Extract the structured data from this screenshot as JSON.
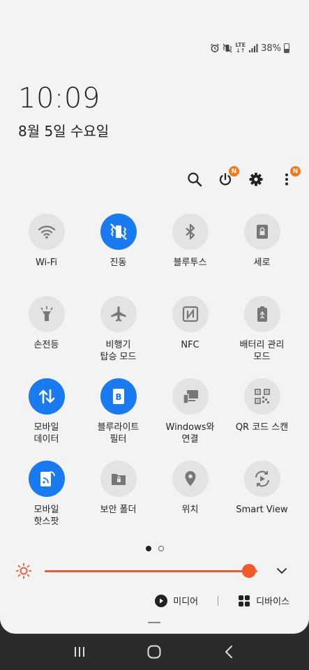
{
  "status_bar": {
    "lte_top": "LTE",
    "lte_bottom": "↓↑",
    "battery_text": "38%",
    "icons": [
      "alarm-icon",
      "vibrate-icon",
      "lte-icon",
      "signal-icon",
      "battery-icon"
    ]
  },
  "clock": {
    "time": "10:09",
    "date": "8월 5일 수요일"
  },
  "header_actions": {
    "power_badge": "N",
    "more_badge": "N"
  },
  "tiles": [
    {
      "label": "Wi-Fi",
      "icon": "wifi-icon",
      "on": false
    },
    {
      "label": "진동",
      "icon": "vibrate-icon",
      "on": true
    },
    {
      "label": "블루투스",
      "icon": "bluetooth-icon",
      "on": false
    },
    {
      "label": "세로",
      "icon": "rotation-lock-icon",
      "on": false
    },
    {
      "label": "손전등",
      "icon": "flashlight-icon",
      "on": false
    },
    {
      "label": "비행기\n탑승 모드",
      "icon": "airplane-icon",
      "on": false
    },
    {
      "label": "NFC",
      "icon": "nfc-icon",
      "on": false
    },
    {
      "label": "배터리 관리\n모드",
      "icon": "battery-saver-icon",
      "on": false
    },
    {
      "label": "모바일\n데이터",
      "icon": "mobile-data-icon",
      "on": true
    },
    {
      "label": "블루라이트\n필터",
      "icon": "blue-light-icon",
      "on": true
    },
    {
      "label": "Windows와\n연결",
      "icon": "link-windows-icon",
      "on": false
    },
    {
      "label": "QR 코드 스캔",
      "icon": "qr-icon",
      "on": false
    },
    {
      "label": "모바일\n핫스팟",
      "icon": "hotspot-icon",
      "on": true
    },
    {
      "label": "보안 폴더",
      "icon": "secure-folder-icon",
      "on": false
    },
    {
      "label": "위치",
      "icon": "location-icon",
      "on": false
    },
    {
      "label": "Smart View",
      "icon": "smart-view-icon",
      "on": false
    }
  ],
  "pager": {
    "current": 1,
    "total": 2
  },
  "brightness": {
    "level": 0.96,
    "accent": "#f35a2a"
  },
  "bottom": {
    "media_label": "미디어",
    "devices_label": "디바이스"
  },
  "colors": {
    "tile_on": "#1a7af0",
    "tile_off": "#e3e3e3",
    "badge": "#f07a1c"
  }
}
